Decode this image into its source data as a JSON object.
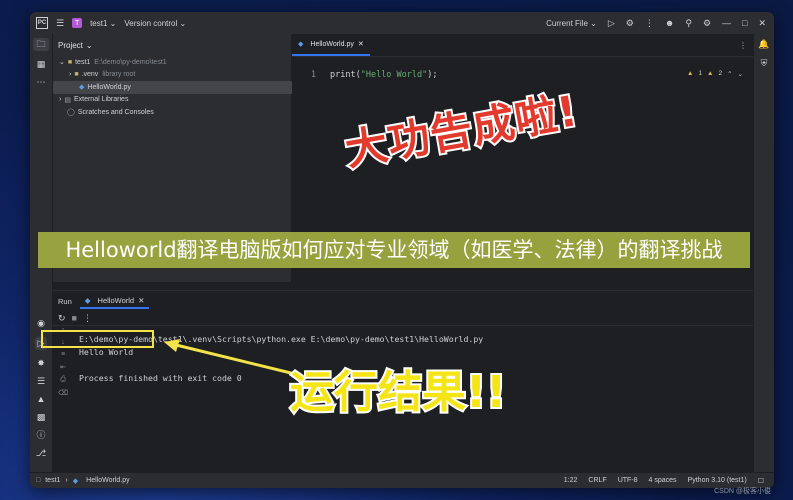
{
  "titlebar": {
    "project_badge": "T",
    "project_name": "test1",
    "vcs": "Version control",
    "run_config": "Current File"
  },
  "project_panel": {
    "title": "Project",
    "tree": [
      {
        "label": "test1",
        "meta": "E:\\demo\\py-demo\\test1"
      },
      {
        "label": ".venv",
        "meta": "library root"
      },
      {
        "label": "HelloWorld.py",
        "meta": ""
      },
      {
        "label": "External Libraries",
        "meta": ""
      },
      {
        "label": "Scratches and Consoles",
        "meta": ""
      }
    ]
  },
  "editor": {
    "tab_label": "HelloWorld.py",
    "line_number": "1",
    "code_fn": "print(",
    "code_str": "\"Hello World\"",
    "code_end": ");",
    "warnings_a": "1",
    "warnings_b": "2"
  },
  "overlay": {
    "stamp": "大功告成啦!",
    "banner": "Helloworld翻译电脑版如何应对专业领域（如医学、法律）的翻译挑战",
    "result": "运行结果!!"
  },
  "run_panel": {
    "label": "Run",
    "tab_label": "HelloWorld",
    "console": [
      "E:\\demo\\py-demo\\test1\\.venv\\Scripts\\python.exe E:\\demo\\py-demo\\test1\\HelloWorld.py",
      "Hello World",
      "",
      "Process finished with exit code 0"
    ]
  },
  "status_bar": {
    "crumb_project": "test1",
    "crumb_file": "HelloWorld.py",
    "position": "1:22",
    "line_sep": "CRLF",
    "encoding": "UTF-8",
    "indent": "4 spaces",
    "interpreter": "Python 3.10 (test1)"
  },
  "watermark": "CSDN @极客小俊"
}
